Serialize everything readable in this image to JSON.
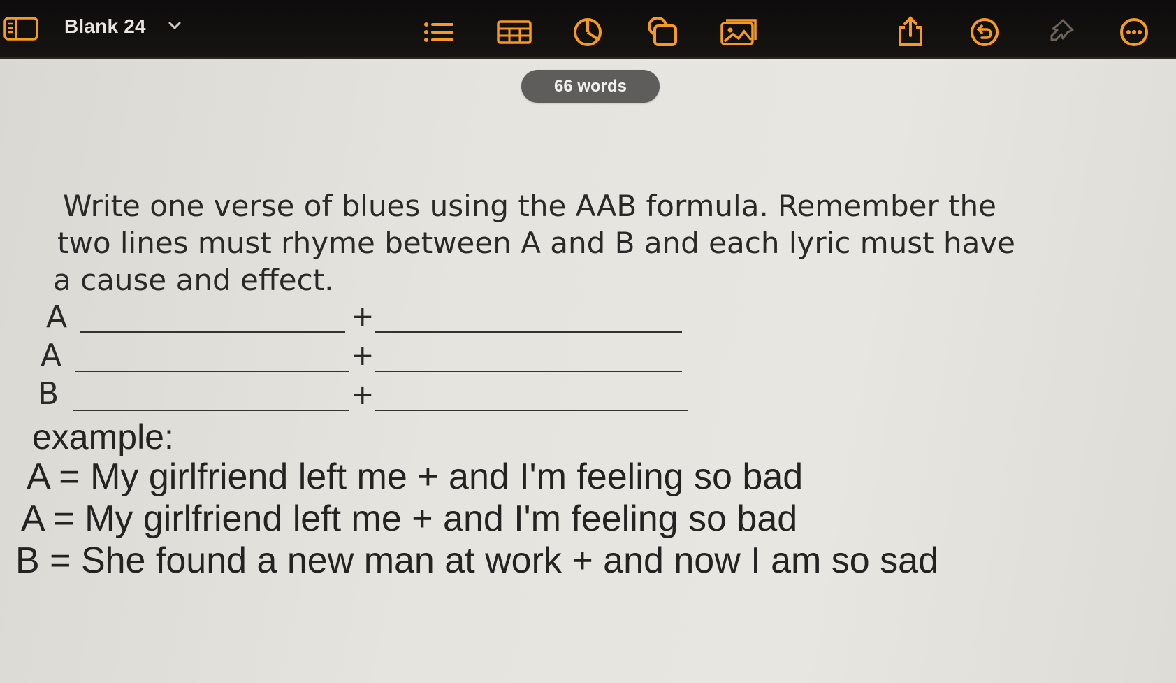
{
  "toolbar": {
    "doc_title": "Blank 24",
    "icons": [
      "sidebar-icon",
      "list-icon",
      "table-icon",
      "chart-icon",
      "shapes-icon",
      "media-icon",
      "share-icon",
      "undo-icon",
      "pin-icon",
      "more-icon"
    ],
    "accent": "#f59a23"
  },
  "word_count": "66 words",
  "prompt": {
    "line1": "Write one verse of blues using the AAB formula. Remember the",
    "line2": "two lines must rhyme between A and B and each lyric must have",
    "line3": "a cause and effect."
  },
  "blanks": [
    {
      "letter": "A",
      "plus": "+"
    },
    {
      "letter": "A",
      "plus": "+"
    },
    {
      "letter": "B",
      "plus": "+"
    }
  ],
  "example": {
    "label": "example:",
    "lines": [
      "A = My girlfriend left me + and I'm feeling so bad",
      "A = My girlfriend left me + and I'm feeling so bad",
      "B = She found a new man at work + and now I am so sad"
    ]
  }
}
